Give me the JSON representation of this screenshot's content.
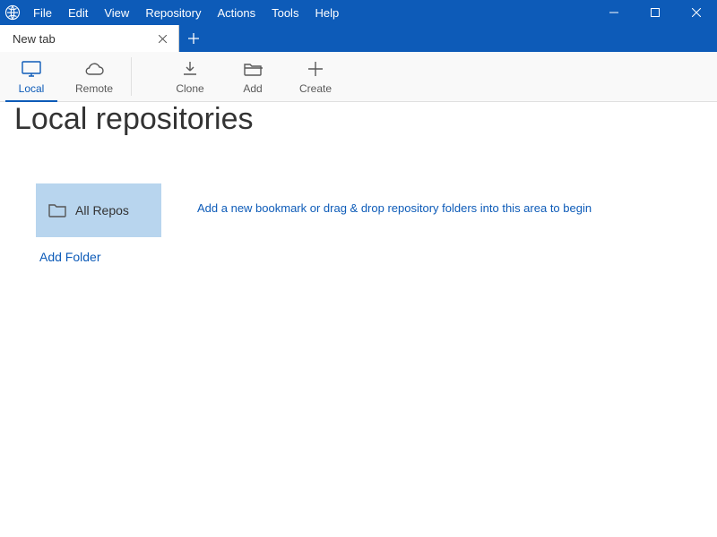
{
  "menu": {
    "items": [
      "File",
      "Edit",
      "View",
      "Repository",
      "Actions",
      "Tools",
      "Help"
    ]
  },
  "tab": {
    "label": "New tab"
  },
  "toolbar": {
    "local": {
      "label": "Local"
    },
    "remote": {
      "label": "Remote"
    },
    "clone": {
      "label": "Clone"
    },
    "add": {
      "label": "Add"
    },
    "create": {
      "label": "Create"
    }
  },
  "page": {
    "heading": "Local repositories",
    "allRepos": "All Repos",
    "addFolder": "Add Folder",
    "hint": "Add a new bookmark or drag & drop repository folders into this area to begin"
  },
  "colors": {
    "accent": "#0d5bb8",
    "selection": "#b8d5ee"
  }
}
